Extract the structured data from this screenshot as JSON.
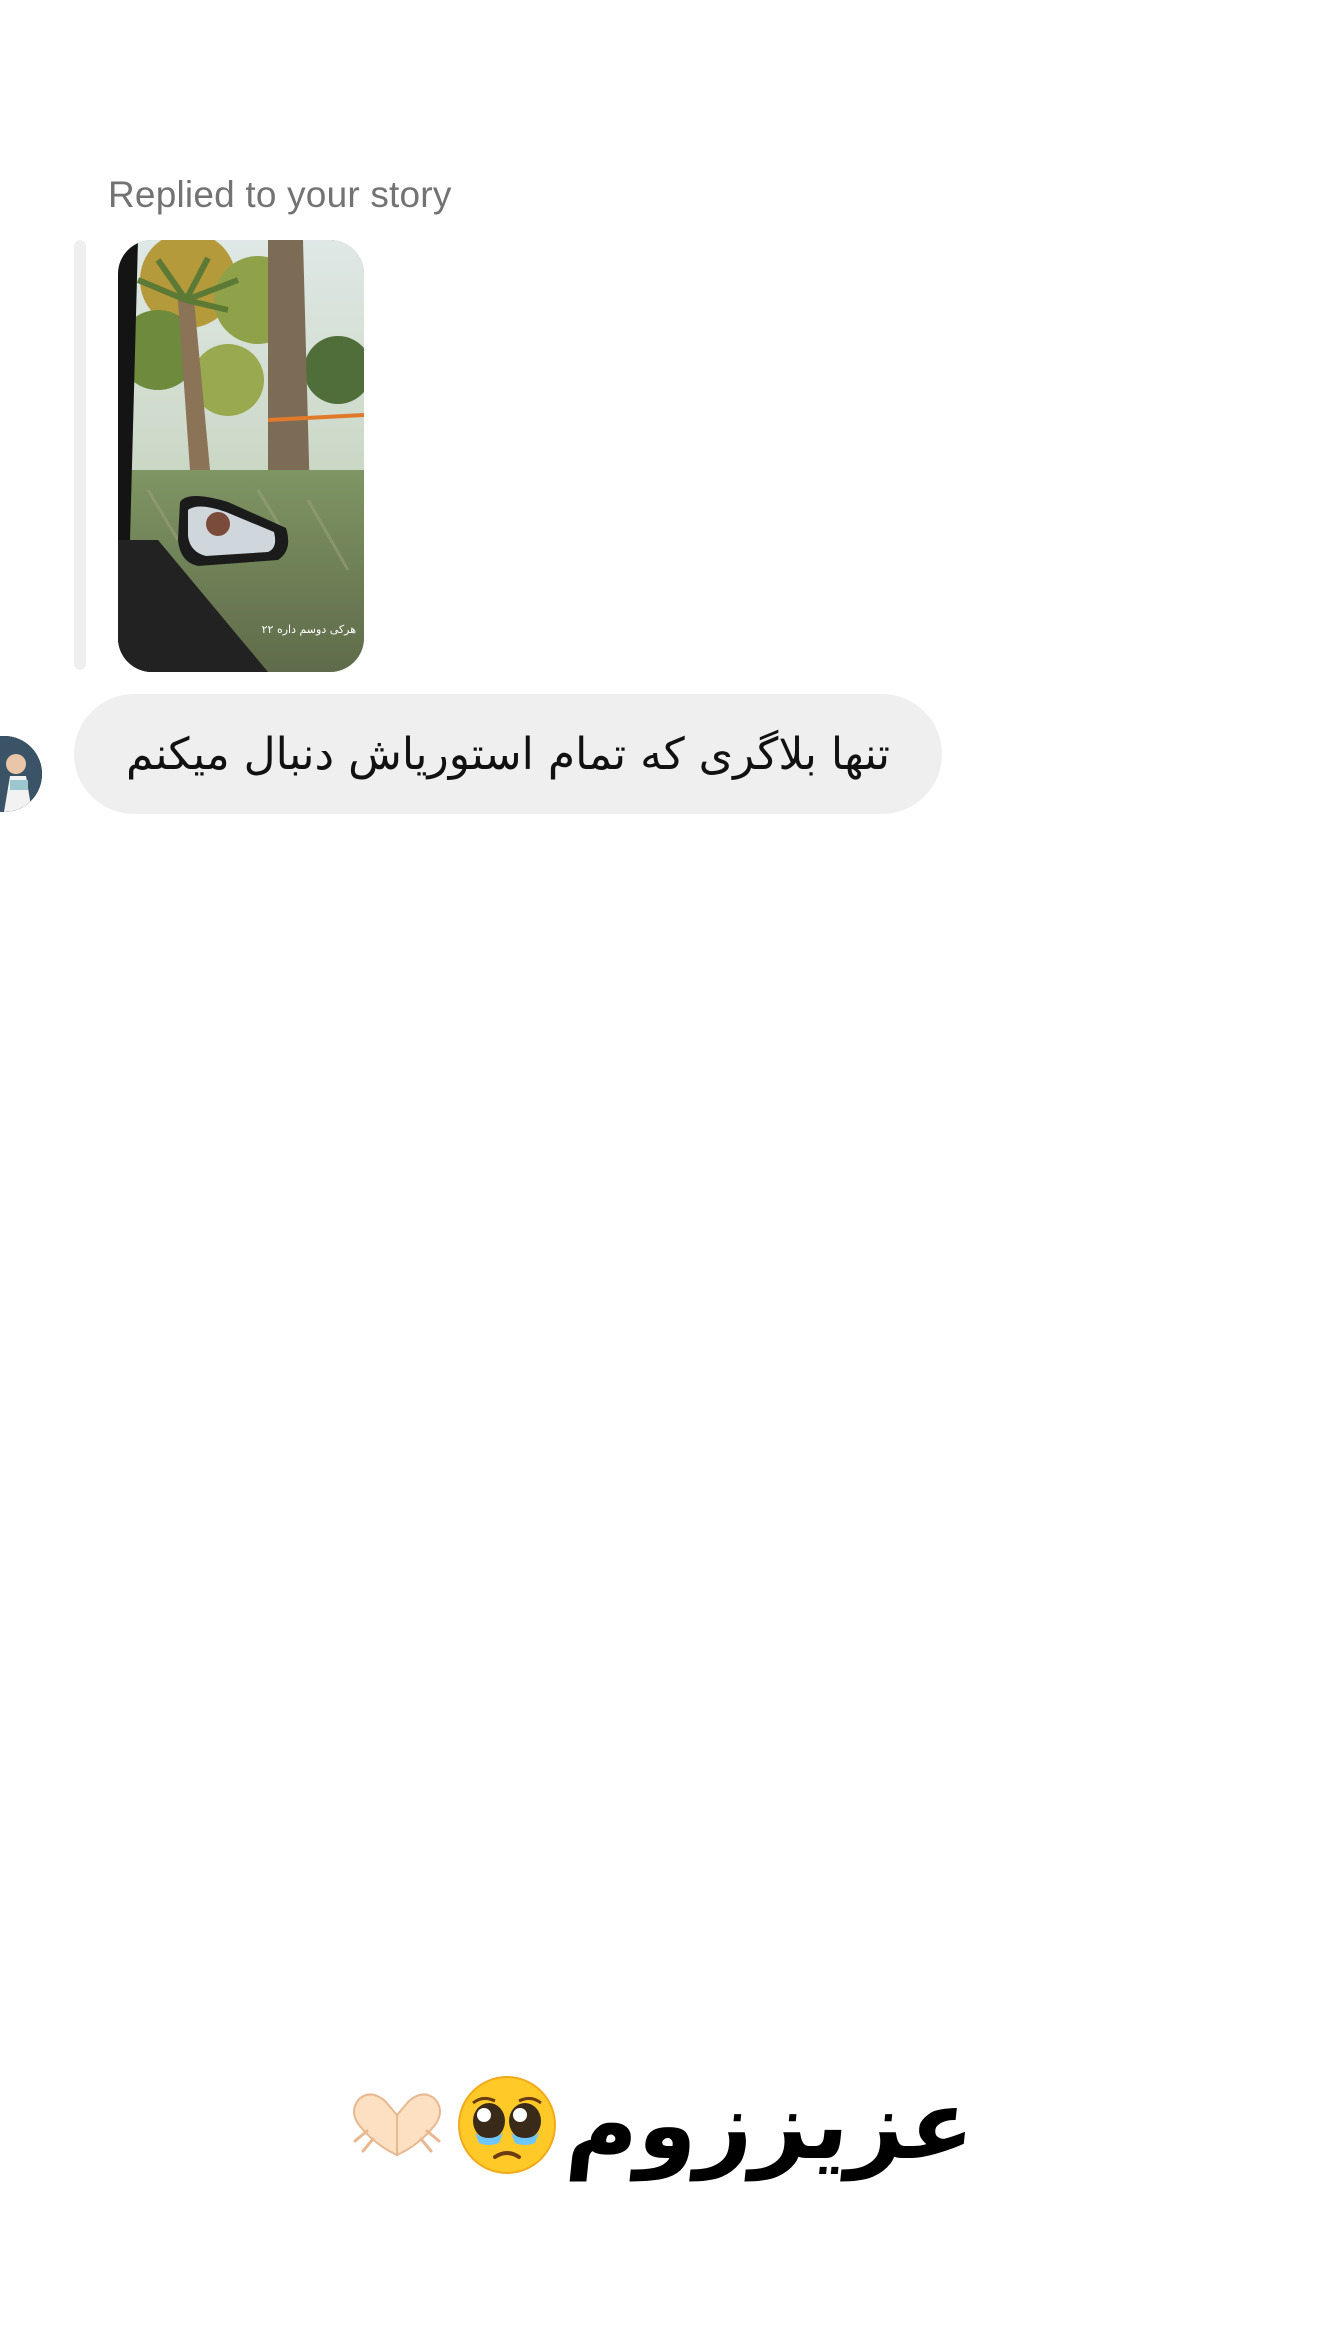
{
  "story_reply": {
    "label": "Replied to your story",
    "thumbnail_icon": "story-thumbnail-image",
    "thumbnail_caption": "هرکی دوسم داره ۲۲"
  },
  "message": {
    "text": "تنها بلاگری که تمام استوریاش دنبال میکنم",
    "avatar_icon": "sender-avatar"
  },
  "sticker": {
    "text": "عزیززوم",
    "emoji_1": "pleading-face-with-tears-emoji",
    "emoji_2": "heart-hands-emoji"
  },
  "colors": {
    "background": "#ffffff",
    "bubble": "#efefef",
    "muted_text": "#737373"
  }
}
